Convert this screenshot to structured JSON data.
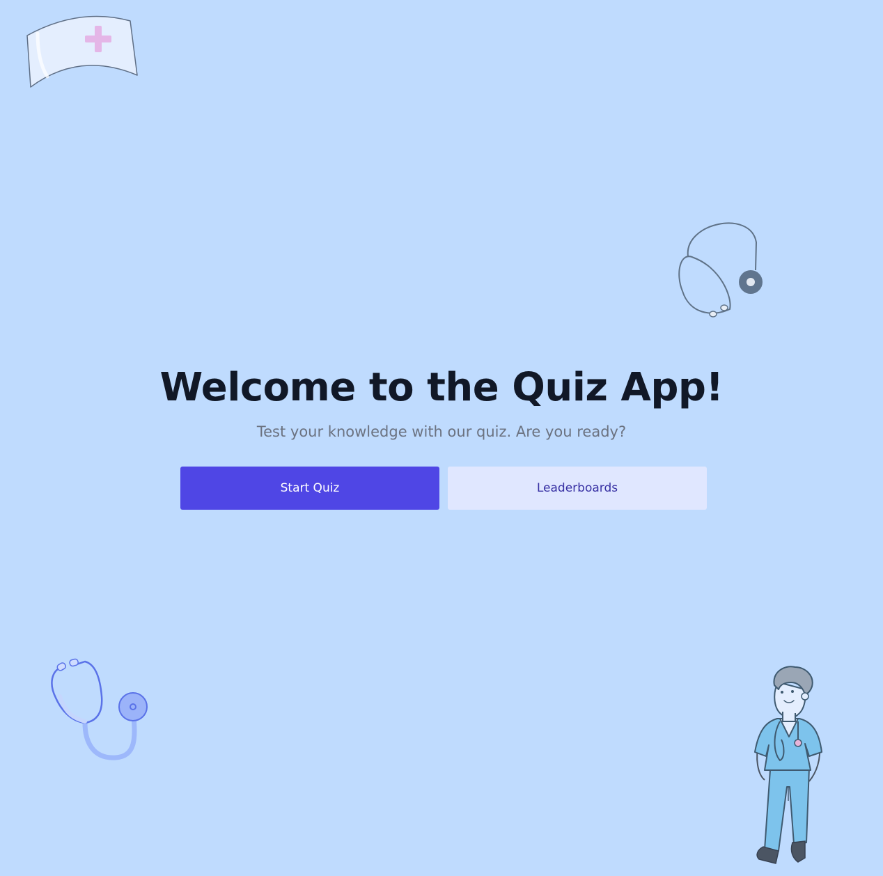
{
  "hero": {
    "title": "Welcome to the Quiz App!",
    "subtitle": "Test your knowledge with our quiz. Are you ready?"
  },
  "actions": {
    "start_label": "Start Quiz",
    "leaderboards_label": "Leaderboards"
  },
  "illustrations": [
    "nurse-cap-icon",
    "stethoscope-icon",
    "stethoscope-icon",
    "doctor-illustration"
  ],
  "colors": {
    "background": "#bfdbfe",
    "title": "#111827",
    "subtitle": "#6b7280",
    "primary_button": "#4f46e5",
    "primary_button_text": "#ffffff",
    "secondary_button": "#e0e7ff",
    "secondary_button_text": "#3730a3"
  }
}
